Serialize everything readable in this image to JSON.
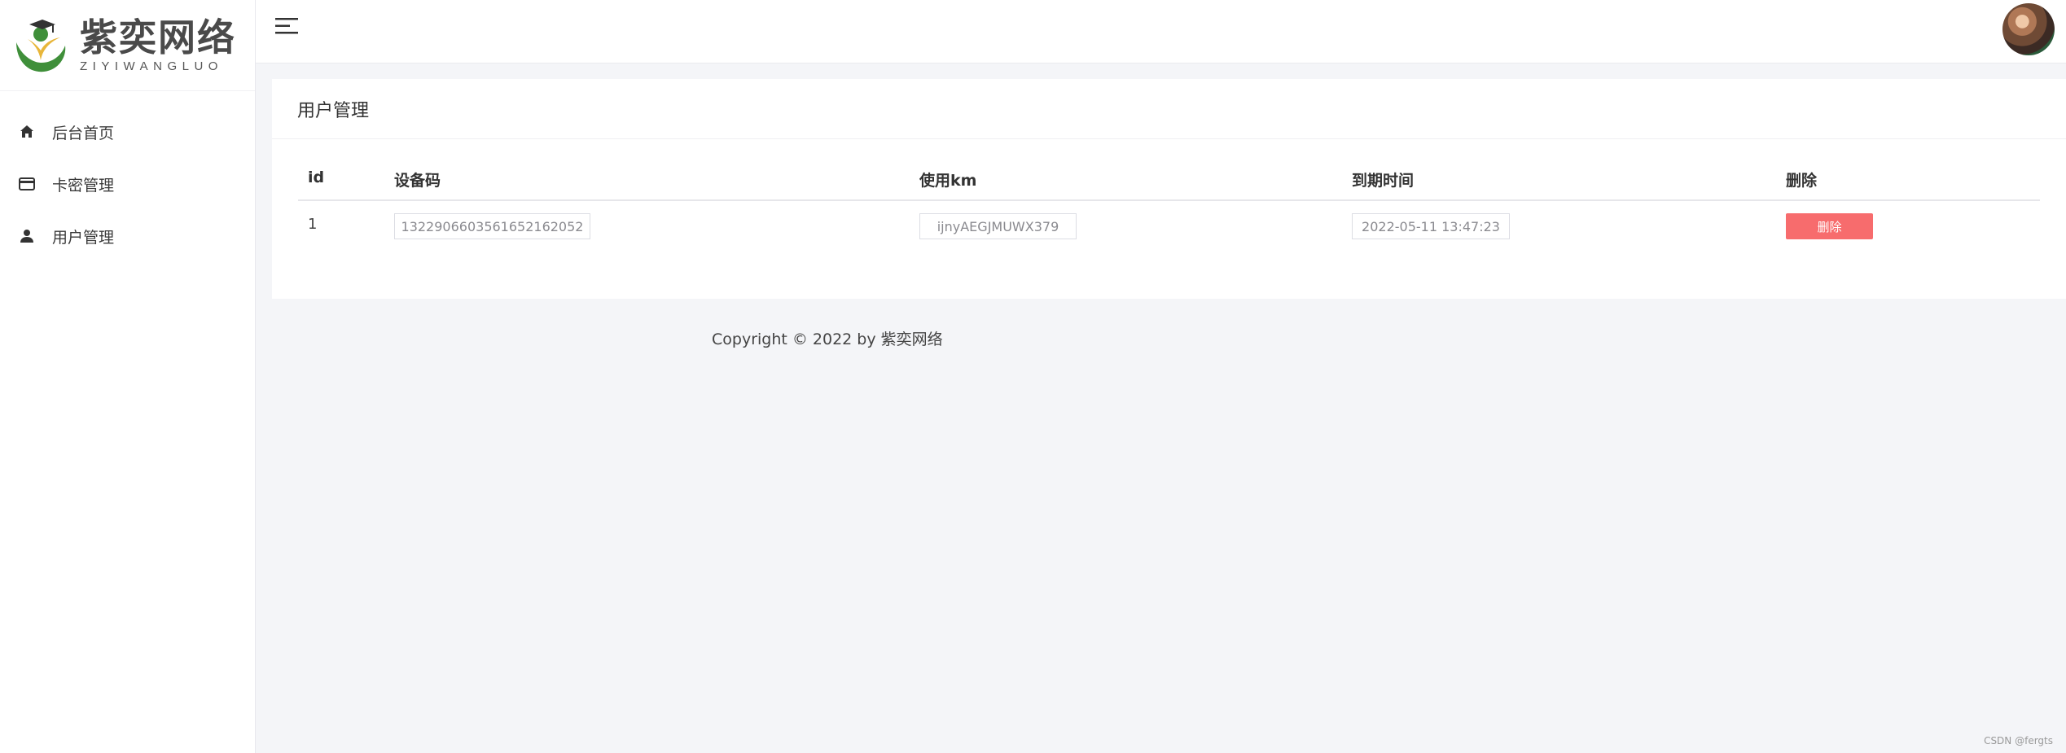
{
  "brand": {
    "title": "紫奕网络",
    "subtitle": "ZIYIWANGLUO",
    "colors": {
      "green": "#3f8f3a",
      "dark": "#4a4a4a"
    }
  },
  "sidebar": {
    "items": [
      {
        "label": "后台首页",
        "icon": "home-icon"
      },
      {
        "label": "卡密管理",
        "icon": "card-icon"
      },
      {
        "label": "用户管理",
        "icon": "user-icon"
      }
    ]
  },
  "header": {
    "menu_icon": "hamburger-menu-icon",
    "avatar": "user-avatar"
  },
  "card": {
    "title": "用户管理",
    "table": {
      "columns": [
        "id",
        "设备码",
        "使用km",
        "到期时间",
        "删除"
      ],
      "rows": [
        {
          "id": "1",
          "device_code": "1322906603561652162052",
          "km": "ijnyAEGJMUWX379",
          "expires": "2022-05-11 13:47:23",
          "delete_label": "删除"
        }
      ]
    }
  },
  "footer": {
    "copyright": "Copyright © 2022 by 紫奕网络"
  },
  "watermark": "CSDN @fergts",
  "colors": {
    "delete_button": "#f76c6d",
    "background": "#f4f5f8"
  }
}
